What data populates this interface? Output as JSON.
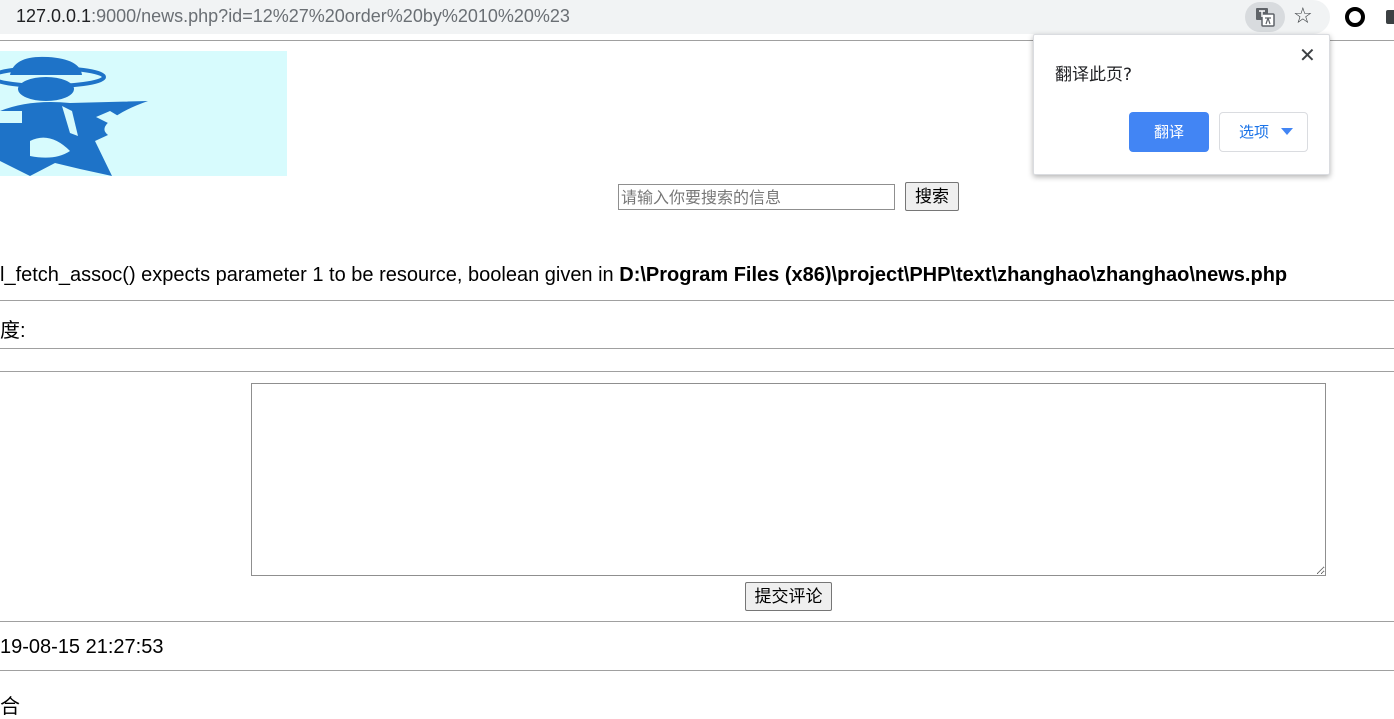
{
  "browser": {
    "url_host": "127.0.0.1",
    "url_path": ":9000/news.php?id=12%27%20order%20by%2010%20%23"
  },
  "search": {
    "placeholder": "请输入你要搜索的信息",
    "button_label": "搜索"
  },
  "error": {
    "message": "l_fetch_assoc() expects parameter 1 to be resource, boolean given in ",
    "path": "D:\\Program Files (x86)\\project\\PHP\\text\\zhanghao\\zhanghao\\news.php"
  },
  "rows": {
    "degree_label": "度:",
    "timestamp": "19-08-15 21:27:53",
    "bottom_char": "合"
  },
  "comment": {
    "submit_label": "提交评论"
  },
  "translate_popup": {
    "title": "翻译此页?",
    "close": "✕",
    "translate_label": "翻译",
    "options_label": "选项"
  },
  "icons": [
    "info-icon",
    "translate-icon",
    "star-icon",
    "extension-icon",
    "close-icon",
    "dropdown-caret-icon"
  ],
  "colors": {
    "popup_primary": "#4285f4",
    "logo_bg": "#d7fbfd",
    "logo_figure": "#1e73c8"
  }
}
